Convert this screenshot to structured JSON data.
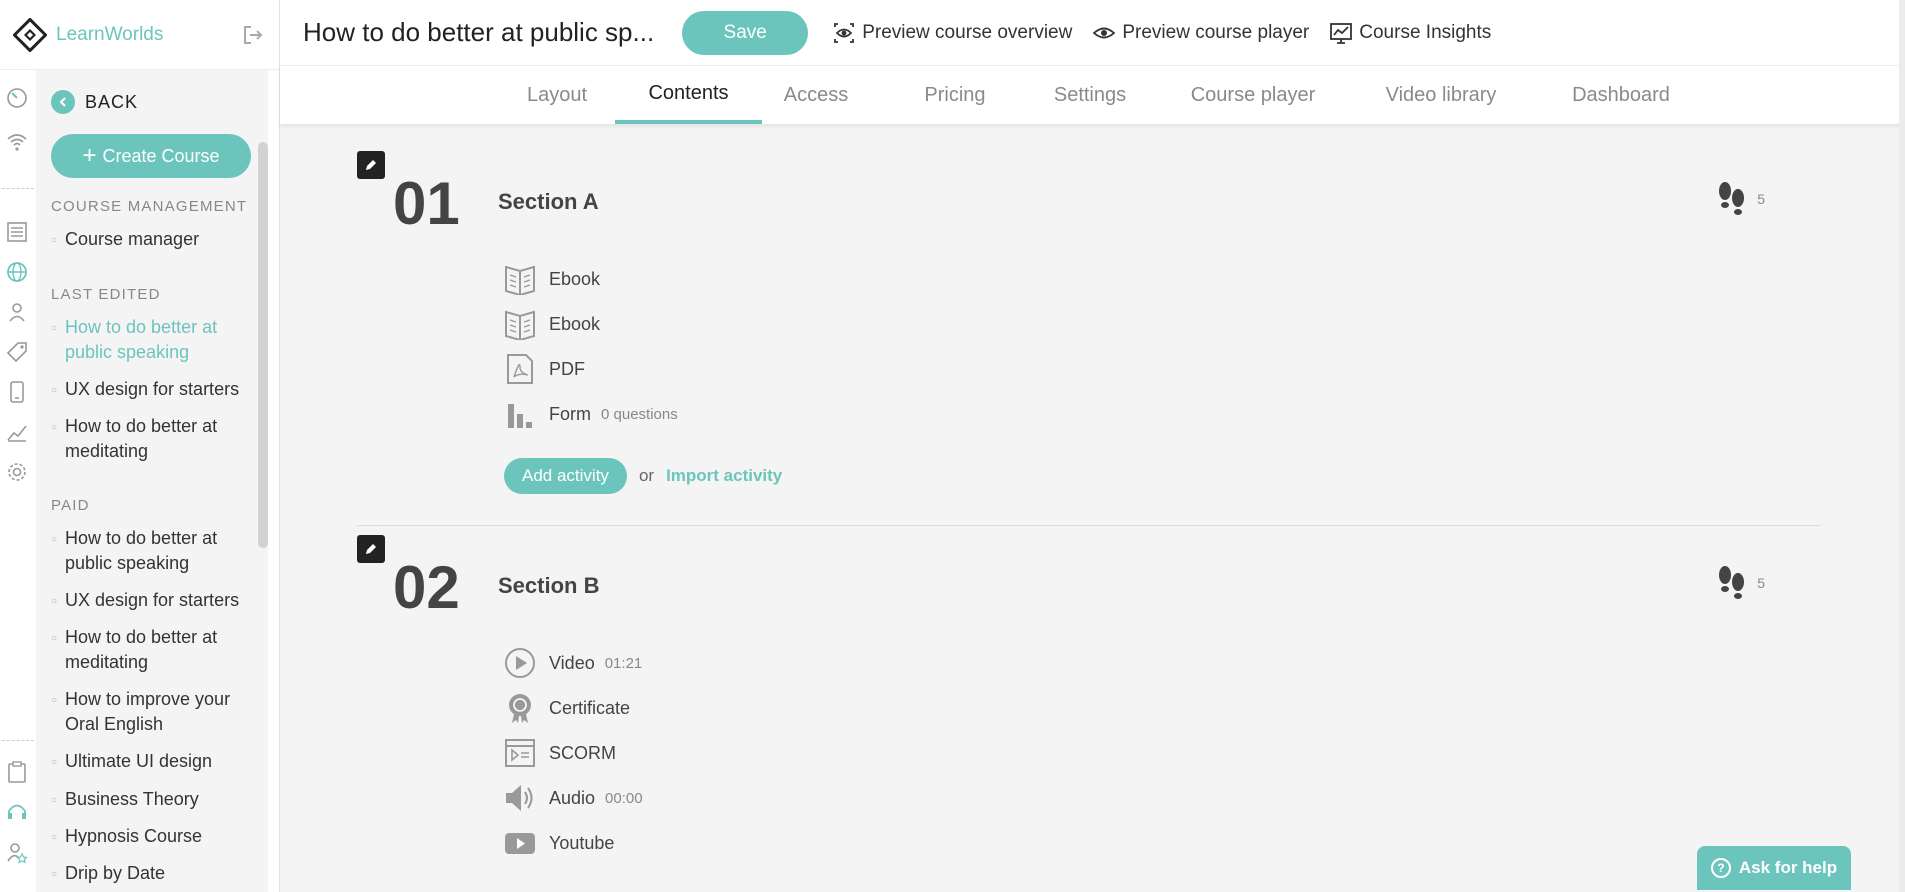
{
  "brand": {
    "name": "LearnWorlds"
  },
  "sidebar": {
    "back_label": "BACK",
    "create_label": "Create Course",
    "course_management_heading": "COURSE MANAGEMENT",
    "course_manager": "Course manager",
    "last_edited_heading": "LAST EDITED",
    "last_edited": [
      "How to do better at public speaking",
      "UX design for starters",
      "How to do better at meditating"
    ],
    "paid_heading": "PAID",
    "paid": [
      "How to do better at public speaking",
      "UX design for starters",
      "How to do better at meditating",
      "How to improve your Oral English",
      "Ultimate UI design",
      "Business Theory",
      "Hypnosis Course",
      "Drip by Date"
    ]
  },
  "topbar": {
    "title": "How to do better at public sp...",
    "save_label": "Save",
    "preview_overview": "Preview course overview",
    "preview_player": "Preview course player",
    "insights": "Course Insights"
  },
  "tabs": [
    "Layout",
    "Contents",
    "Access",
    "Pricing",
    "Settings",
    "Course player",
    "Video library",
    "Dashboard"
  ],
  "active_tab": "Contents",
  "sections": [
    {
      "number": "01",
      "title": "Section A",
      "steps": "5",
      "activities": [
        {
          "icon": "ebook-icon",
          "name": "Ebook",
          "meta": ""
        },
        {
          "icon": "ebook-icon",
          "name": "Ebook",
          "meta": ""
        },
        {
          "icon": "pdf-icon",
          "name": "PDF",
          "meta": ""
        },
        {
          "icon": "form-icon",
          "name": "Form",
          "meta": "0 questions"
        }
      ],
      "add_label": "Add activity",
      "or_label": "or",
      "import_label": "Import activity"
    },
    {
      "number": "02",
      "title": "Section B",
      "steps": "5",
      "activities": [
        {
          "icon": "video-icon",
          "name": "Video",
          "meta": "01:21"
        },
        {
          "icon": "certificate-icon",
          "name": "Certificate",
          "meta": ""
        },
        {
          "icon": "scorm-icon",
          "name": "SCORM",
          "meta": ""
        },
        {
          "icon": "audio-icon",
          "name": "Audio",
          "meta": "00:00"
        },
        {
          "icon": "youtube-icon",
          "name": "Youtube",
          "meta": ""
        }
      ]
    }
  ],
  "help": {
    "label": "Ask for help"
  },
  "colors": {
    "accent": "#6cc5bd",
    "text": "#444444",
    "background": "#f4f4f4"
  }
}
